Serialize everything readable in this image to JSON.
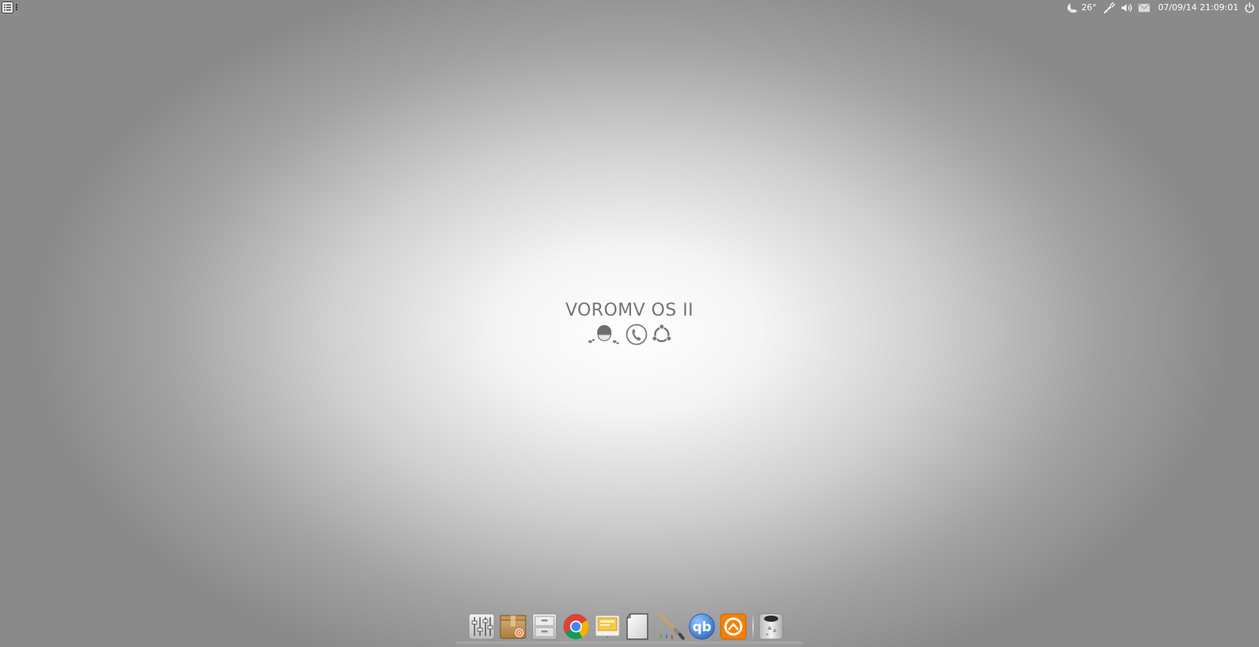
{
  "top_bar": {
    "left": {
      "menu_icon": "list-menu-icon",
      "overflow_icon": "vertical-dots-icon"
    },
    "right": {
      "weather_icon": "moon-cloud-icon",
      "temperature": "26°",
      "network_icon": "wired-network-icon",
      "volume_icon": "speaker-volume-icon",
      "mail_icon": "envelope-icon",
      "clock": "07/09/14 21:09:01",
      "power_icon": "power-icon"
    }
  },
  "desktop": {
    "title": "VOROMV OS II",
    "glyphs": [
      "footprints-helmet-icon",
      "telephone-circle-icon",
      "ubuntu-logo-icon"
    ]
  },
  "dock": {
    "items": [
      {
        "icon": "mixer-sliders-icon"
      },
      {
        "icon": "package-box-icon"
      },
      {
        "icon": "file-cabinet-icon"
      },
      {
        "icon": "chrome-icon"
      },
      {
        "icon": "presentation-icon"
      },
      {
        "icon": "document-page-icon"
      },
      {
        "icon": "paint-brush-icon"
      },
      {
        "icon": "qbittorrent-icon",
        "label": "qb"
      },
      {
        "icon": "grooveshark-icon"
      },
      {
        "icon": "trash-icon"
      }
    ]
  },
  "colors": {
    "title_text": "#737373",
    "tray_text": "#ffffff",
    "chrome_red": "#db4437",
    "chrome_green": "#0f9d58",
    "chrome_yellow": "#f4b400",
    "chrome_blue": "#4285f4",
    "qb_blue": "#3a7bd5",
    "groove_orange": "#f77f00"
  }
}
